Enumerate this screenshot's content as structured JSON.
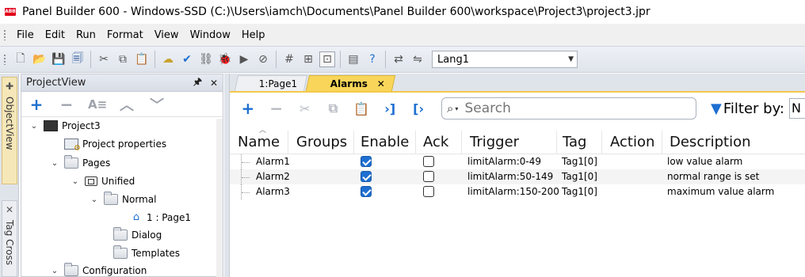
{
  "window": {
    "title": "Panel Builder 600 - Windows-SSD (C:)\\Users\\iamch\\Documents\\Panel Builder 600\\workspace\\Project3\\project3.jpr",
    "logo_text": "ABB"
  },
  "menu": [
    "File",
    "Edit",
    "Run",
    "Format",
    "View",
    "Window",
    "Help"
  ],
  "toolbar": {
    "language": "Lang1"
  },
  "side_tabs": {
    "object_view": "ObjectView",
    "tag_cross": "Tag Cross"
  },
  "project_view": {
    "title": "ProjectView",
    "pin": "🖈",
    "close": "✕",
    "tree": [
      {
        "label": "Project3",
        "icon": "monitor-icon",
        "expander": "⌄",
        "level": 0
      },
      {
        "label": "Project properties",
        "icon": "project-properties-icon",
        "expander": "",
        "level": 1
      },
      {
        "label": "Pages",
        "icon": "folder-icon",
        "expander": "⌄",
        "level": 1
      },
      {
        "label": "Unified",
        "icon": "unified-icon",
        "expander": "⌄",
        "level": 2
      },
      {
        "label": "Normal",
        "icon": "folder-icon",
        "expander": "⌄",
        "level": 3
      },
      {
        "label": "1 : Page1",
        "icon": "home-page-icon",
        "expander": "",
        "level": 4
      },
      {
        "label": "Dialog",
        "icon": "folder-icon",
        "expander": "",
        "level": 3
      },
      {
        "label": "Templates",
        "icon": "folder-icon",
        "expander": "",
        "level": 3
      },
      {
        "label": "Configuration",
        "icon": "folder-icon",
        "expander": "⌄",
        "level": 1
      }
    ]
  },
  "editor": {
    "tabs": [
      {
        "label": "1:Page1",
        "active": false
      },
      {
        "label": "Alarms",
        "active": true,
        "close": "✕"
      }
    ],
    "search_placeholder": "Search",
    "filter_label": "Filter by:",
    "filter_value": "N",
    "columns": [
      "Name",
      "Groups",
      "Enable",
      "Ack",
      "Trigger",
      "Tag",
      "Action",
      "Description"
    ],
    "rows": [
      {
        "name": "Alarm1",
        "groups": "",
        "enable": true,
        "ack": false,
        "trigger": "limitAlarm:0-49",
        "tag": "Tag1[0]",
        "action": "",
        "description": "low value alarm"
      },
      {
        "name": "Alarm2",
        "groups": "",
        "enable": true,
        "ack": false,
        "trigger": "limitAlarm:50-149",
        "tag": "Tag1[0]",
        "action": "",
        "description": "normal range is set"
      },
      {
        "name": "Alarm3",
        "groups": "",
        "enable": true,
        "ack": false,
        "trigger": "limitAlarm:150-200",
        "tag": "Tag1[0]",
        "action": "",
        "description": "maximum value alarm"
      }
    ]
  },
  "colors": {
    "accent_blue": "#1e6fd0",
    "active_tab": "#f9d65a",
    "object_view_tab": "#f6e7b8"
  }
}
